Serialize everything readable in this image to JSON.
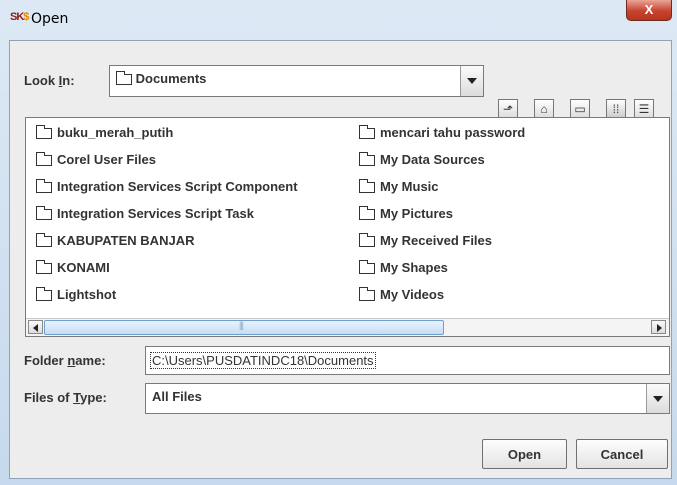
{
  "window": {
    "title": "Open",
    "icon_text_a": "S",
    "icon_text_b": "K",
    "icon_text_c": "$",
    "close_glyph": "X"
  },
  "look_in": {
    "label_pre": "Look ",
    "label_mnemonic": "I",
    "label_post": "n:",
    "value": "Documents"
  },
  "toolbar": {
    "buttons": [
      "up-one-level-icon",
      "home-icon",
      "new-folder-icon",
      "list-view-icon",
      "details-view-icon"
    ]
  },
  "files": {
    "column_1": [
      "buku_merah_putih",
      "Corel User Files",
      "Integration Services Script Component",
      "Integration Services Script Task",
      "KABUPATEN BANJAR",
      "KONAMI",
      "Lightshot"
    ],
    "column_2": [
      "mencari tahu password",
      "My Data Sources",
      "My Music",
      "My Pictures",
      "My Received Files",
      "My Shapes",
      "My Videos"
    ]
  },
  "folder_name": {
    "label_pre": "Folder ",
    "label_mnemonic": "n",
    "label_post": "ame:",
    "value": "C:\\Users\\PUSDATINDC18\\Documents"
  },
  "files_of_type": {
    "label_pre": "Files of ",
    "label_mnemonic": "T",
    "label_post": "ype:",
    "value": "All Files"
  },
  "buttons": {
    "open": "Open",
    "cancel": "Cancel"
  },
  "colors": {
    "close_button": "#c7442f",
    "scroll_thumb": "#c5ddf4"
  }
}
